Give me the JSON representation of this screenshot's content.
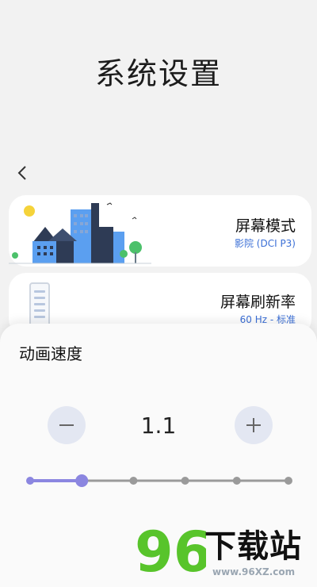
{
  "header": {
    "title": "系统设置"
  },
  "nav": {
    "back_icon": "chevron-left-icon"
  },
  "cards": {
    "screen_mode": {
      "title": "屏幕模式",
      "value": "影院 (DCI P3)"
    },
    "refresh_rate": {
      "title": "屏幕刷新率",
      "value": "60 Hz - 标准"
    }
  },
  "sheet": {
    "title": "动画速度",
    "value": "1.1",
    "slider": {
      "level_fraction": 0.2,
      "stops": 6
    }
  },
  "watermark": {
    "brand": "下载站",
    "url": "www.96XZ.com",
    "number": "96"
  },
  "colors": {
    "accent": "#8b86e0",
    "link": "#3b6fd6",
    "stepper_bg": "#e3e7f2"
  }
}
